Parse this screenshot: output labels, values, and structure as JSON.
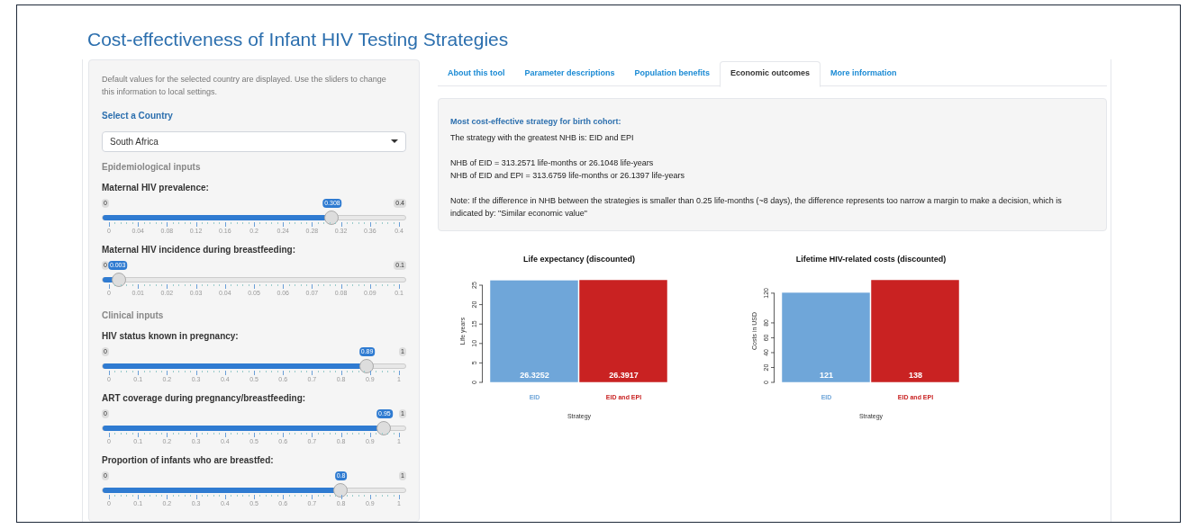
{
  "title": "Cost-effectiveness of Infant HIV Testing Strategies",
  "sidebar": {
    "intro": "Default values for the selected country are displayed. Use the sliders to change this information to local settings.",
    "country_label": "Select a Country",
    "country": "South Africa",
    "sections": [
      {
        "heading": "Epidemiological inputs",
        "sliders": [
          {
            "label": "Maternal HIV prevalence:",
            "min": "0",
            "max": "0.4",
            "value": "0.308",
            "level": 0.77,
            "ticks": [
              "0",
              "0.04",
              "0.08",
              "0.12",
              "0.16",
              "0.2",
              "0.24",
              "0.28",
              "0.32",
              "0.36",
              "0.4"
            ]
          },
          {
            "label": "Maternal HIV incidence during breastfeeding:",
            "min": "0",
            "max": "0.1",
            "value": "0.003",
            "level": 0.03,
            "ticks": [
              "0",
              "0.01",
              "0.02",
              "0.03",
              "0.04",
              "0.05",
              "0.06",
              "0.07",
              "0.08",
              "0.09",
              "0.1"
            ]
          }
        ]
      },
      {
        "heading": "Clinical inputs",
        "sliders": [
          {
            "label": "HIV status known in pregnancy:",
            "min": "0",
            "max": "1",
            "value": "0.89",
            "level": 0.89,
            "ticks": [
              "0",
              "0.1",
              "0.2",
              "0.3",
              "0.4",
              "0.5",
              "0.6",
              "0.7",
              "0.8",
              "0.9",
              "1"
            ]
          },
          {
            "label": "ART coverage during pregnancy/breastfeeding:",
            "min": "0",
            "max": "1",
            "value": "0.95",
            "level": 0.95,
            "ticks": [
              "0",
              "0.1",
              "0.2",
              "0.3",
              "0.4",
              "0.5",
              "0.6",
              "0.7",
              "0.8",
              "0.9",
              "1"
            ]
          },
          {
            "label": "Proportion of infants who are breastfed:",
            "min": "0",
            "max": "1",
            "value": "0.8",
            "level": 0.8,
            "ticks": [
              "0",
              "0.1",
              "0.2",
              "0.3",
              "0.4",
              "0.5",
              "0.6",
              "0.7",
              "0.8",
              "0.9",
              "1"
            ]
          }
        ]
      }
    ]
  },
  "tabs": [
    {
      "label": "About this tool",
      "selected": false
    },
    {
      "label": "Parameter descriptions",
      "selected": false
    },
    {
      "label": "Population benefits",
      "selected": false
    },
    {
      "label": "Economic outcomes",
      "selected": true
    },
    {
      "label": "More information",
      "selected": false
    }
  ],
  "result": {
    "heading": "Most cost-effective strategy for birth cohort:",
    "lines": [
      "The strategy with the greatest NHB is: EID and EPI",
      "NHB of EID = 313.2571 life-months or 26.1048 life-years",
      "NHB of EID and EPI = 313.6759 life-months or 26.1397 life-years",
      "Note: If the difference in NHB between the strategies is smaller than 0.25 life-months (~8 days), the difference represents too narrow a margin to make a decision, which is indicated by: \"Similar economic value\""
    ]
  },
  "charts": [
    {
      "chart_data": {
        "type": "bar",
        "title": "Life expectancy (discounted)",
        "xlabel": "Strategy",
        "ylabel": "Life years",
        "categories": [
          "EID",
          "EID and EPI"
        ],
        "values": [
          26.3252,
          26.3917
        ],
        "colors": [
          "#6fa6d9",
          "#c92222"
        ],
        "ylim": [
          0,
          26.3917
        ],
        "yticks": [
          0,
          5,
          10,
          15,
          20,
          25
        ],
        "value_labels": [
          "26.3252",
          "26.3917"
        ]
      }
    },
    {
      "chart_data": {
        "type": "bar",
        "title": "Lifetime HIV-related costs (discounted)",
        "xlabel": "Strategy",
        "ylabel": "Costs in USD",
        "categories": [
          "EID",
          "EID and EPI"
        ],
        "values": [
          121,
          138
        ],
        "colors": [
          "#6fa6d9",
          "#c92222"
        ],
        "ylim": [
          0,
          138
        ],
        "yticks": [
          0,
          20,
          40,
          60,
          80,
          120
        ],
        "value_labels": [
          "121",
          "138"
        ]
      }
    }
  ]
}
